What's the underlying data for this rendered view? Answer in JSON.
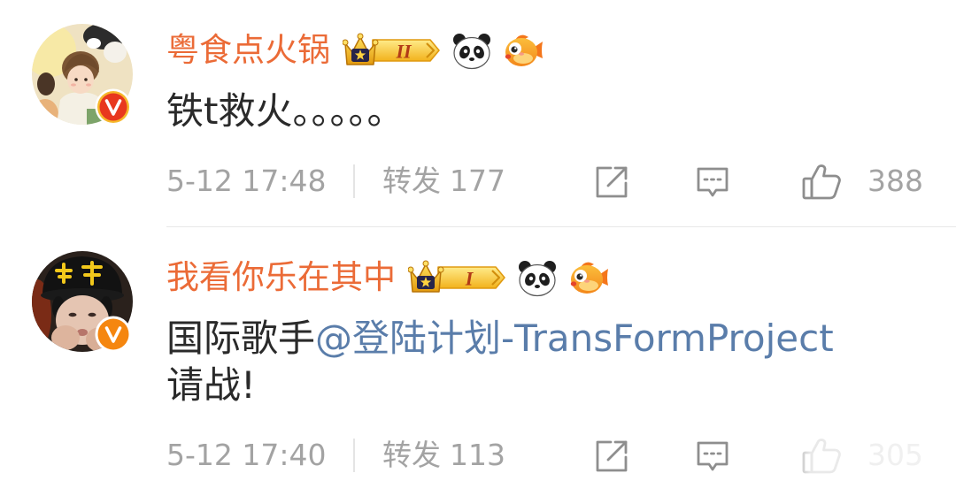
{
  "theme": {
    "username_color": "#EB6B37",
    "text_color": "#2A2A2A",
    "meta_color": "#A3A3A3",
    "mention_color": "#5A7DAA",
    "icon_color": "#8E8E8E",
    "divider_color": "#E8E8E8"
  },
  "icons": {
    "share": "share-icon",
    "comment": "comment-icon",
    "like": "like-icon",
    "fan_badge": "crown-badge-icon",
    "panda": "panda-icon",
    "fish": "fish-icon",
    "verified": "verified-badge-icon"
  },
  "comments": [
    {
      "username": "粤食点火锅",
      "fan_level": "II",
      "verified_badge_color": "#E8381E",
      "content": "铁t救火。。。。。",
      "time": "5-12 17:48",
      "repost_label": "转发",
      "repost_count": "177",
      "like_count": "388"
    },
    {
      "username": "我看你乐在其中",
      "fan_level": "I",
      "verified_badge_color": "#F5860F",
      "content": {
        "text": "国际歌手",
        "mention": "@登陆计划-TransFormProject",
        "tail": "请战!"
      },
      "time": "5-12 17:40",
      "repost_label": "转发",
      "repost_count": "113",
      "like_count": "305"
    }
  ]
}
